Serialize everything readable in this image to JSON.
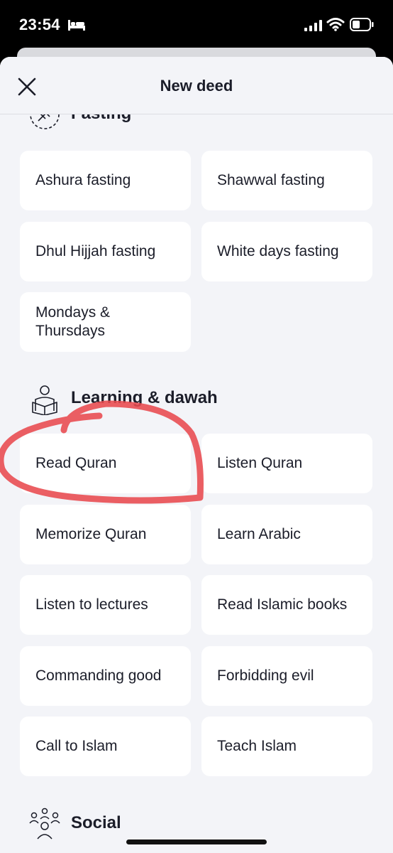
{
  "status_bar": {
    "time": "23:54"
  },
  "header": {
    "title": "New deed"
  },
  "sections": {
    "fasting": {
      "title": "Fasting",
      "items": [
        "Ashura fasting",
        "Shawwal fasting",
        "Dhul Hijjah fasting",
        "White days fasting",
        "Mondays & Thursdays"
      ]
    },
    "learning": {
      "title": "Learning & dawah",
      "items": [
        "Read Quran",
        "Listen Quran",
        "Memorize Quran",
        "Learn Arabic",
        "Listen to lectures",
        "Read Islamic books",
        "Commanding good",
        "Forbidding evil",
        "Call to Islam",
        "Teach Islam"
      ]
    },
    "social": {
      "title": "Social"
    }
  },
  "colors": {
    "background": "#f3f4f8",
    "card": "#ffffff",
    "text": "#1b1d29",
    "annotation_stroke": "#e8494d"
  }
}
